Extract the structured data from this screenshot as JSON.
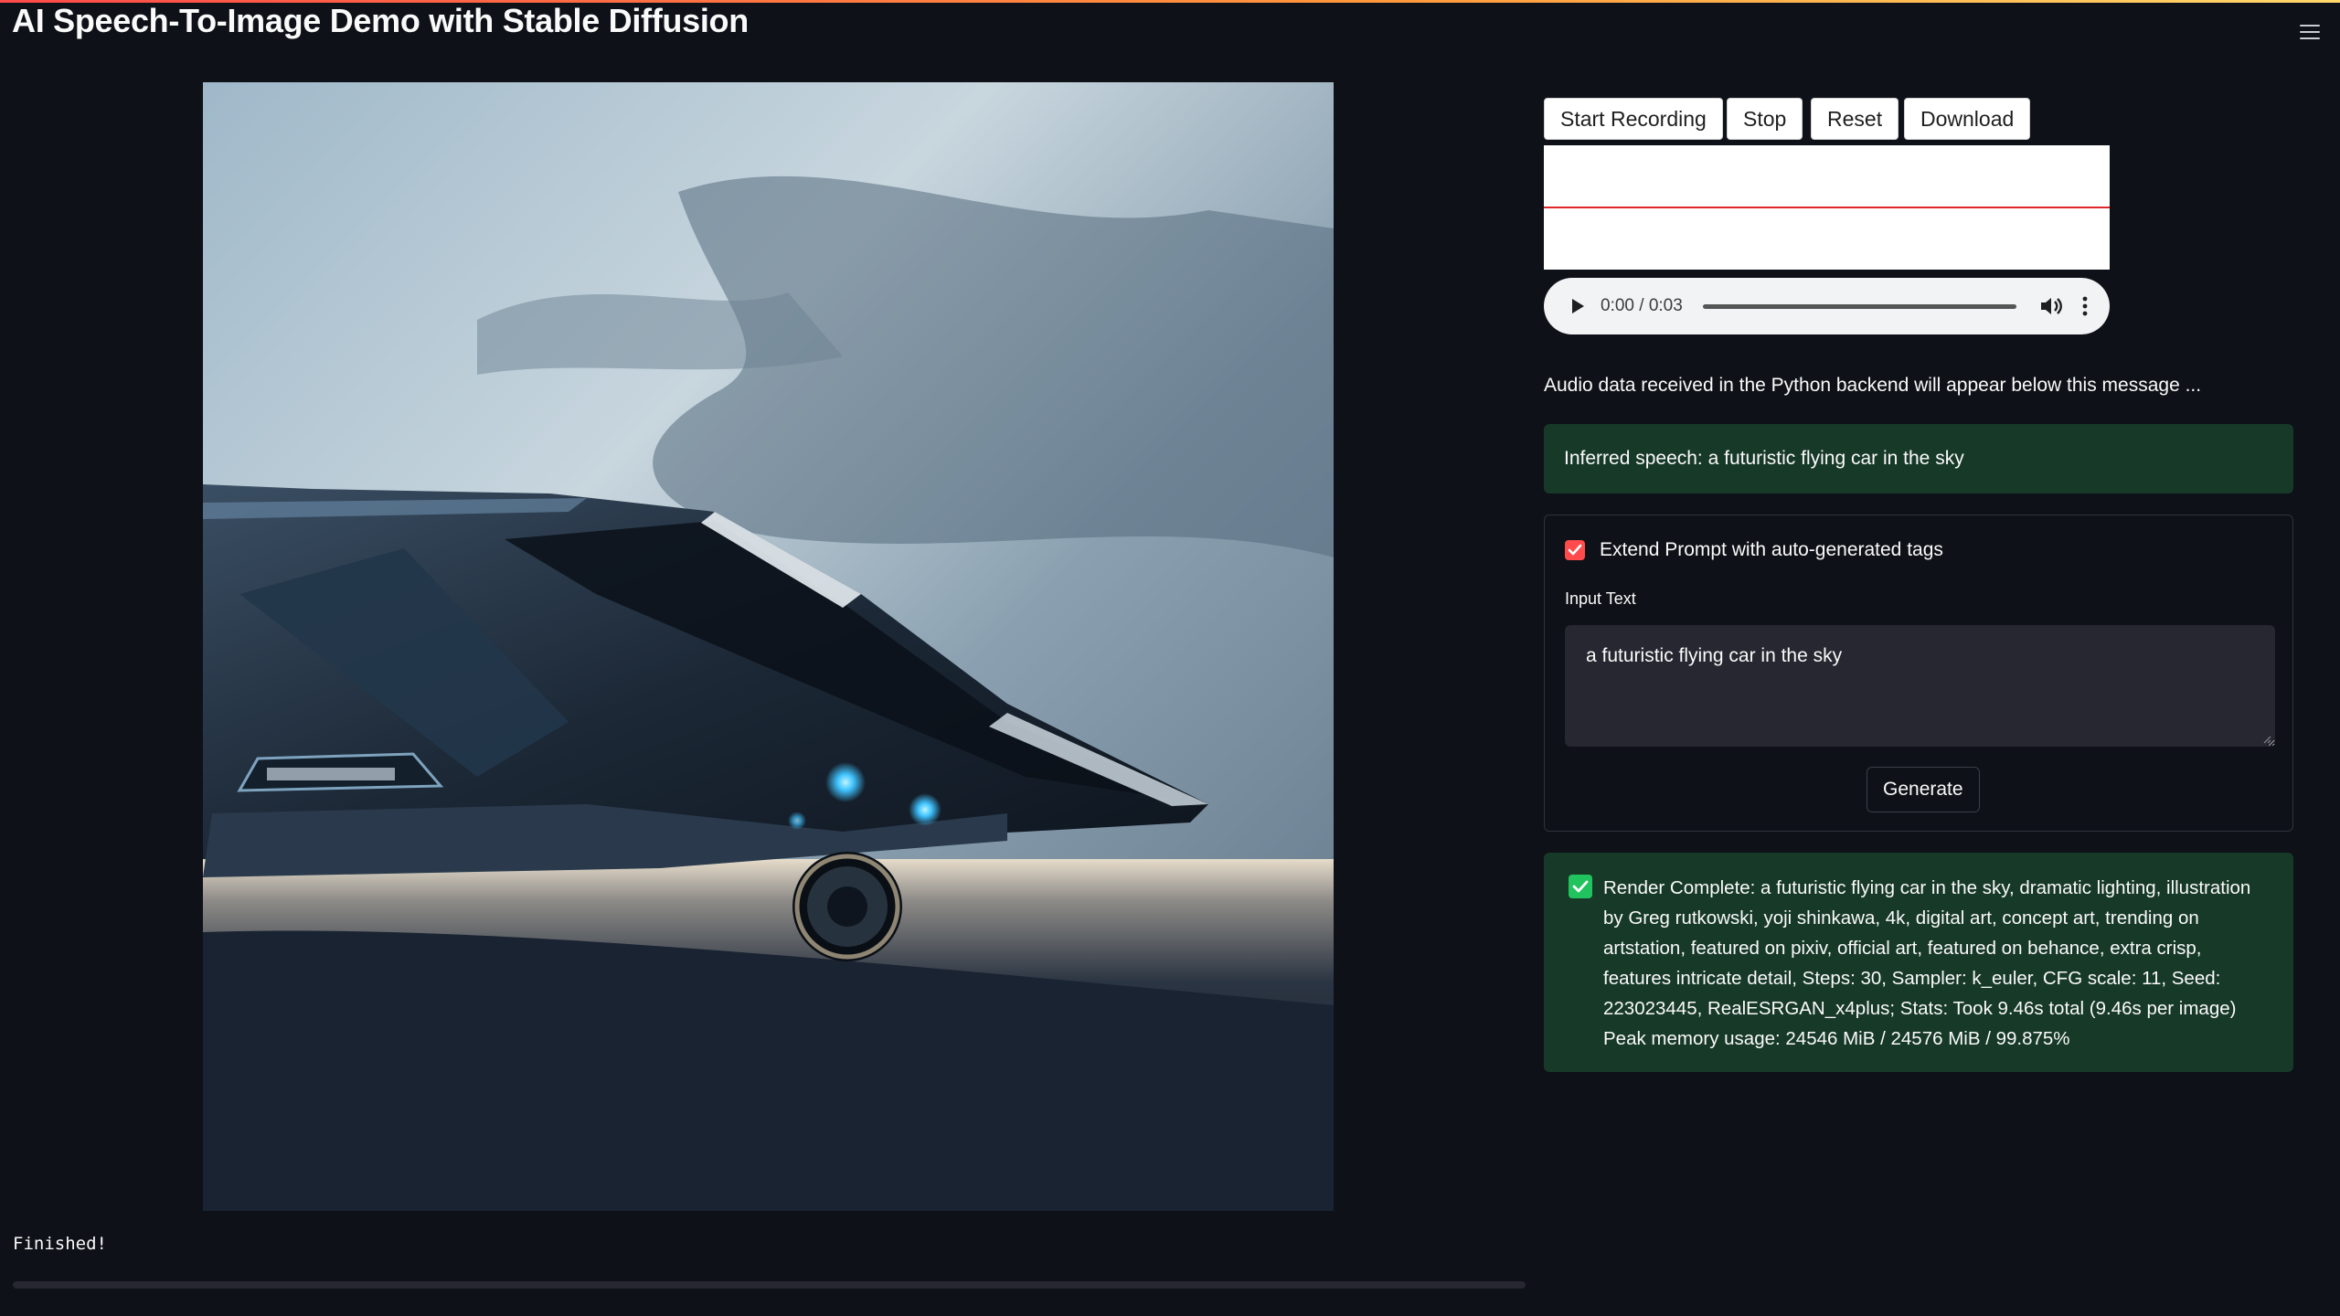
{
  "header": {
    "title": "AI Speech-To-Image Demo with Stable Diffusion",
    "menu_icon": "hamburger-menu-icon"
  },
  "recorder": {
    "start_label": "Start Recording",
    "stop_label": "Stop",
    "reset_label": "Reset",
    "download_label": "Download"
  },
  "audio_player": {
    "time": "0:00 / 0:03",
    "progress": 0,
    "icons": [
      "play-icon",
      "volume-icon",
      "more-vert-icon"
    ]
  },
  "backend_message": "Audio data received in the Python backend will appear below this message ...",
  "speech_result": "Inferred speech: a futuristic flying car in the sky",
  "form": {
    "checkbox_label": "Extend Prompt with auto-generated tags",
    "checkbox_checked": true,
    "input_label": "Input Text",
    "input_value": "a futuristic flying car in the sky",
    "generate_label": "Generate"
  },
  "render_result": {
    "text": "Render Complete: a futuristic flying car in the sky, dramatic lighting, illustration by Greg rutkowski, yoji shinkawa, 4k, digital art, concept art, trending on artstation, featured on pixiv, official art, featured on behance, extra crisp, features intricate detail, Steps: 30, Sampler: k_euler, CFG scale: 11, Seed: 223023445, RealESRGAN_x4plus; Stats: Took 9.46s total (9.46s per image) Peak memory usage: 24546 MiB / 24576 MiB / 99.875%"
  },
  "status": {
    "text": "Finished!",
    "progress": 0
  },
  "colors": {
    "background": "#0e1117",
    "accent_red": "#ff4b4b",
    "success_bg": "#173928",
    "success_check": "#21c35e"
  }
}
